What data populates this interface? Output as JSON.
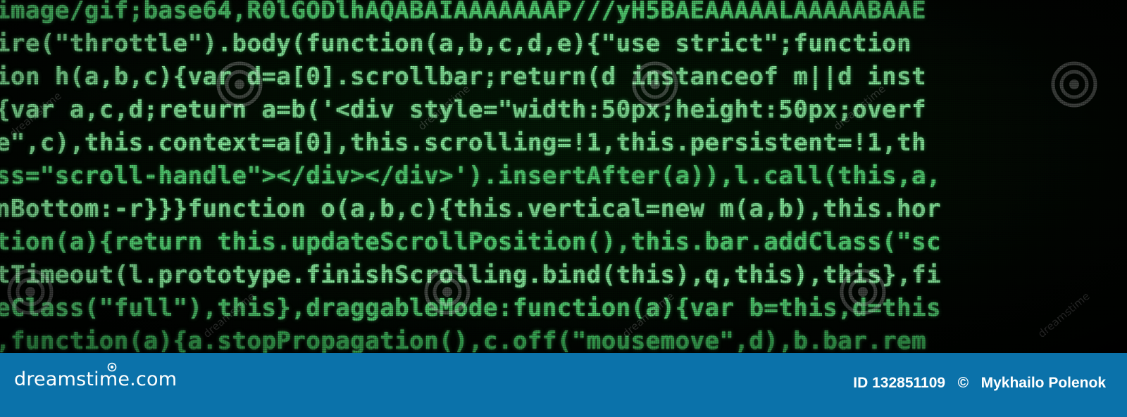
{
  "code_lines": [
    "image/gif;base64,R0lGODlhAQABAIAAAAAAAP///yH5BAEAAAAALAAAAABAAE",
    "ire(\"throttle\").body(function(a,b,c,d,e){\"use strict\";function ",
    "ion h(a,b,c){var d=a[0].scrollbar;return(d instanceof m||d inst",
    "{var a,c,d;return a=b('<div style=\"width:50px;height:50px;overf",
    "e\",c),this.context=a[0],this.scrolling=!1,this.persistent=!1,th",
    "ss=\"scroll-handle\"></div></div>').insertAfter(a)),l.call(this,a,",
    "nBottom:-r}}}function o(a,b,c){this.vertical=new m(a,b),this.hor",
    "tion(a){return this.updateScrollPosition(),this.bar.addClass(\"sc",
    "tTimeout(l.prototype.finishScrolling.bind(this),q,this),this},fi",
    "eClass(\"full\"),this},draggableMode:function(a){var b=this,d=this",
    ",function(a){a.stopPropagation(),c.off(\"mousemove\",d),b.bar.rem"
  ],
  "watermark": {
    "text": "dreamstime"
  },
  "footer": {
    "logo": "dreamstime.com",
    "image_id": "ID 132851109",
    "copyright_symbol": "©",
    "author": "Mykhailo Polenok",
    "bar_color": "#0b72aa"
  },
  "colors": {
    "code_green": "#58e07a",
    "background": "#020402"
  }
}
